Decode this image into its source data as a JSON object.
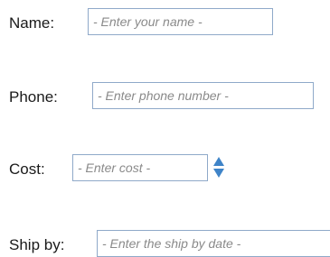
{
  "form": {
    "name": {
      "label": "Name:",
      "value": "",
      "placeholder": "- Enter your name -"
    },
    "phone": {
      "label": "Phone:",
      "value": "",
      "placeholder": "- Enter phone number -"
    },
    "cost": {
      "label": "Cost:",
      "value": "",
      "placeholder": "- Enter cost -",
      "spinner_icon": "up-down-spinner-icon"
    },
    "ship_by": {
      "label": "Ship by:",
      "value": "",
      "placeholder": "- Enter the ship by date -"
    }
  },
  "colors": {
    "field_border": "#8fa9c9",
    "placeholder": "#8a8a8a",
    "spinner_arrow": "#3f84c8",
    "label_text": "#1a1a1a"
  }
}
